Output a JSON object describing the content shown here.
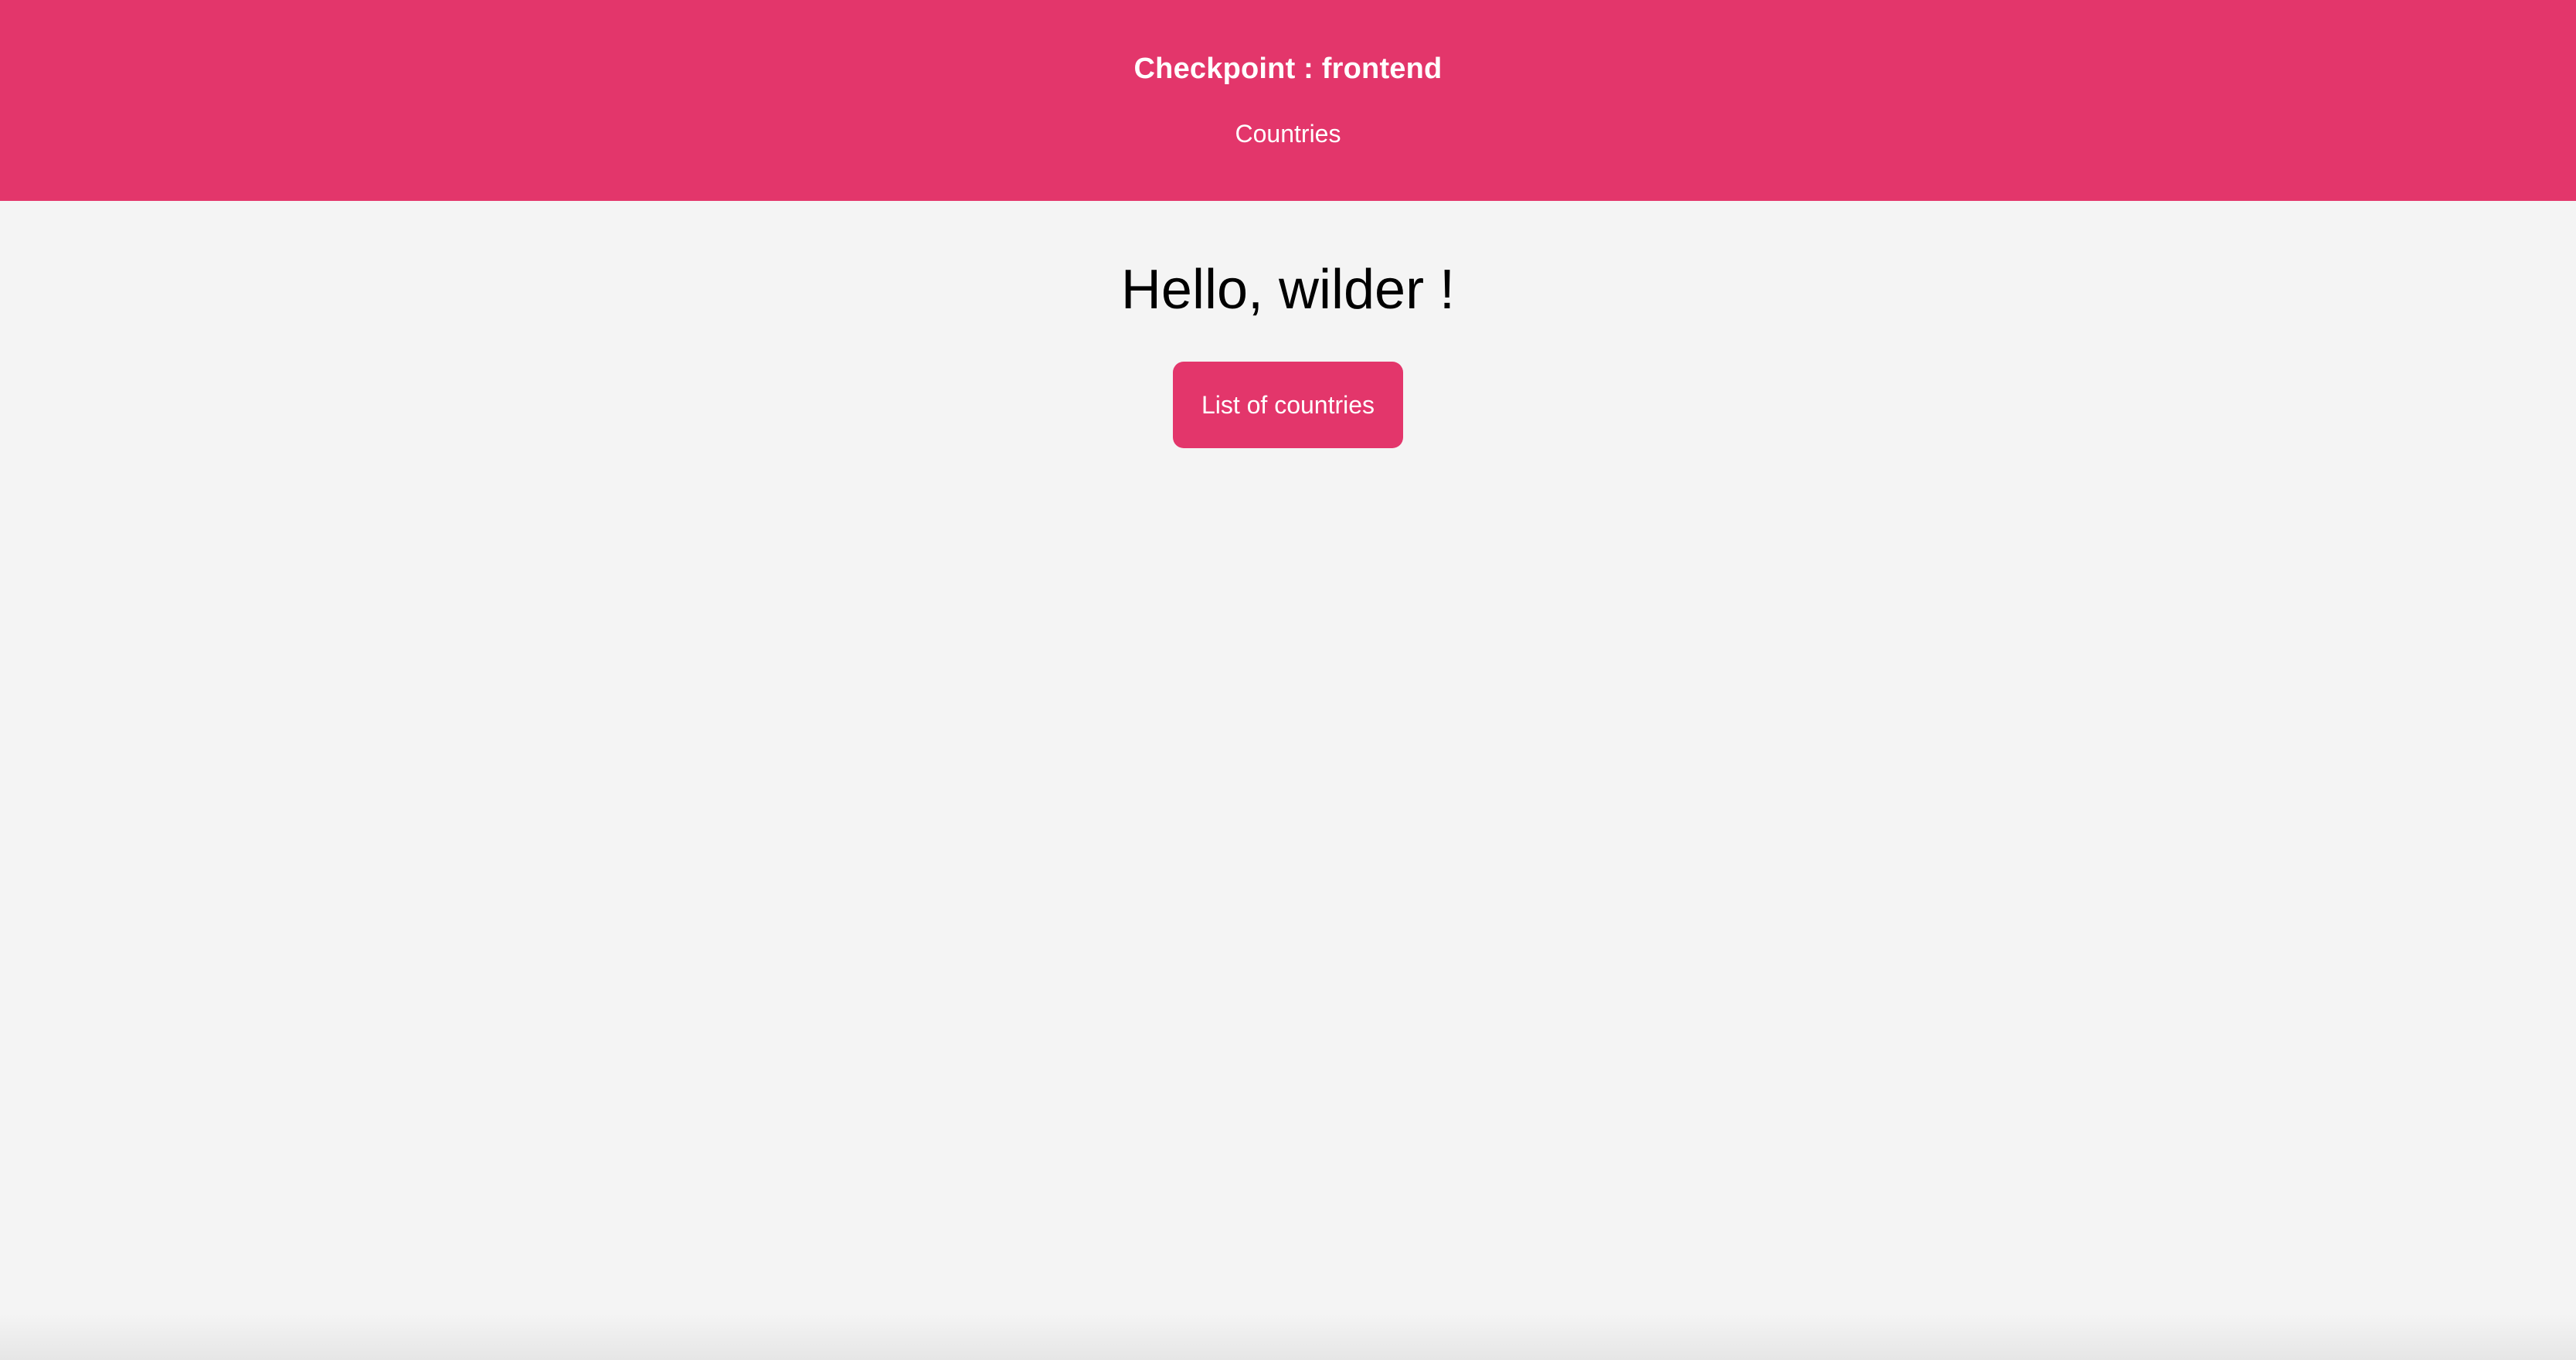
{
  "theme": {
    "accent": "#e3366b",
    "background": "#f4f4f4"
  },
  "header": {
    "title": "Checkpoint : frontend",
    "nav": {
      "countries_link": "Countries"
    }
  },
  "main": {
    "greeting": "Hello, wilder !",
    "list_button_label": "List of countries"
  }
}
